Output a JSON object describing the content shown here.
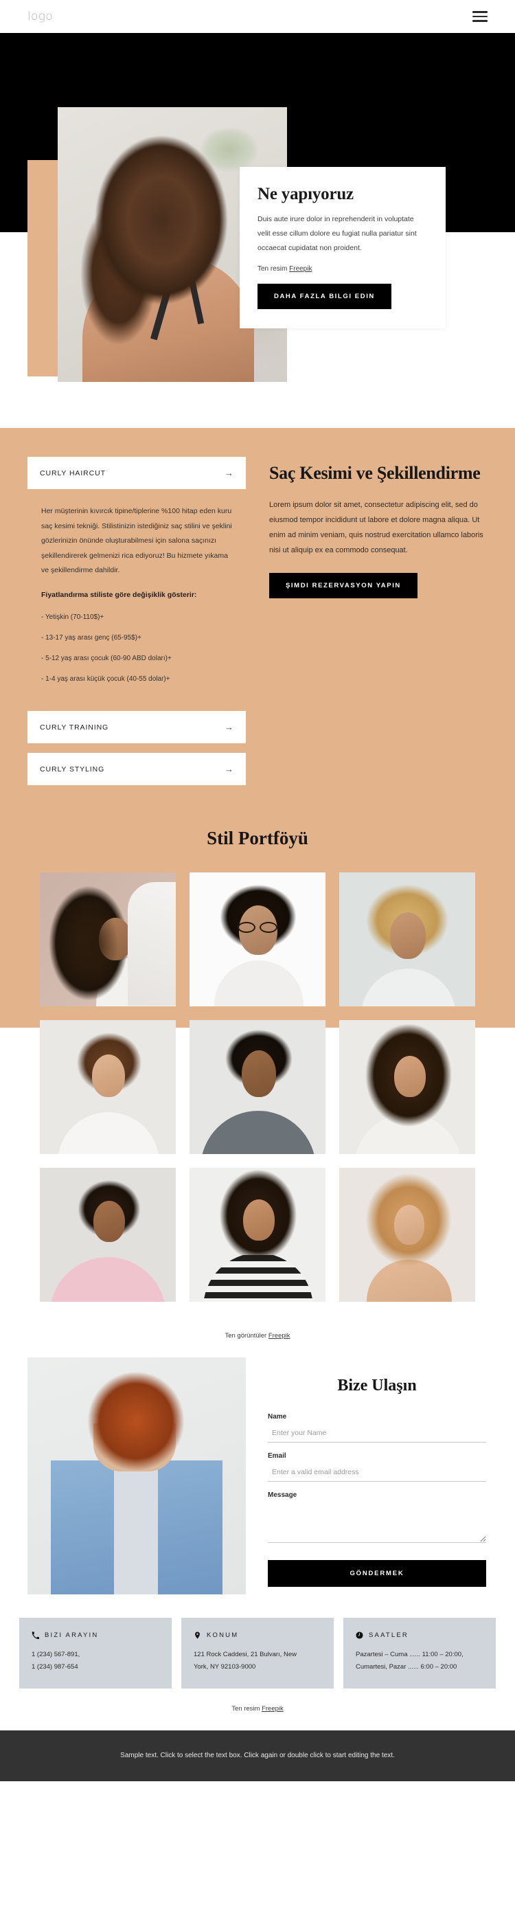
{
  "header": {
    "logo": "logo",
    "menu_icon": "hamburger-menu-icon"
  },
  "hero": {
    "card_title": "Ne yapıyoruz",
    "card_text": "Duis aute irure dolor in reprehenderit in voluptate velit esse cillum dolore eu fugiat nulla pariatur sint occaecat cupidatat non proident.",
    "credit_prefix": "Ten resim ",
    "credit_link": "Freepik",
    "cta": "DAHA FAZLA BILGI EDIN"
  },
  "services": {
    "accordion_open": {
      "label": "CURLY HAIRCUT",
      "arrow": "→"
    },
    "body_paragraph": "Her müşterinin kıvırcık tipine/tiplerine %100 hitap eden kuru saç kesimi tekniği. Stilistinizin istediğiniz saç stilini ve şeklini gözlerinizin önünde oluşturabilmesi için salona saçınızı şekillendirerek gelmenizi rica ediyoruz! Bu hizmete yıkama ve şekillendirme dahildir.",
    "pricing_heading": "Fiyatlandırma stiliste göre değişiklik gösterir:",
    "pricing_items": [
      "- Yetişkin (70-110$)+",
      "- 13-17 yaş arası genç (65-95$)+",
      "- 5-12 yaş arası çocuk (60-90 ABD doları)+",
      "- 1-4 yaş arası küçük çocuk (40-55 dolar)+"
    ],
    "accordion_items": [
      {
        "label": "CURLY TRAINING",
        "arrow": "→"
      },
      {
        "label": "CURLY STYLING",
        "arrow": "→"
      }
    ],
    "title": "Saç Kesimi ve Şekillendirme",
    "paragraph": "Lorem ipsum dolor sit amet, consectetur adipiscing elit, sed do eiusmod tempor incididunt ut labore et dolore magna aliqua. Ut enim ad minim veniam, quis nostrud exercitation ullamco laboris nisi ut aliquip ex ea commodo consequat.",
    "cta": "ŞIMDI REZERVASYON YAPIN"
  },
  "portfolio": {
    "title": "Stil Portföyü",
    "credit_prefix": "Ten görüntüler ",
    "credit_link": "Freepik",
    "images": [
      {
        "alt": "curly-hair-portrait-1"
      },
      {
        "alt": "curly-hair-portrait-2"
      },
      {
        "alt": "curly-hair-portrait-3"
      },
      {
        "alt": "curly-hair-portrait-4"
      },
      {
        "alt": "curly-hair-portrait-5"
      },
      {
        "alt": "curly-hair-portrait-6"
      },
      {
        "alt": "curly-hair-portrait-7"
      },
      {
        "alt": "curly-hair-portrait-8"
      },
      {
        "alt": "curly-hair-portrait-9"
      }
    ]
  },
  "contact": {
    "title": "Bize Ulaşın",
    "fields": [
      {
        "label": "Name",
        "placeholder": "Enter your Name",
        "value": ""
      },
      {
        "label": "Email",
        "placeholder": "Enter a valid email address",
        "value": ""
      },
      {
        "label": "Message",
        "placeholder": "",
        "value": ""
      }
    ],
    "submit": "GÖNDERMEK",
    "photo_alt": "red-haired-woman-denim-jacket"
  },
  "info_cards": [
    {
      "icon": "phone-icon",
      "title": "BIZI ARAYIN",
      "lines": [
        "1 (234) 567-891,",
        "1 (234) 987-654"
      ]
    },
    {
      "icon": "location-pin-icon",
      "title": "KONUM",
      "lines": [
        "121 Rock Caddesi, 21 Bulvarı, New",
        "York, NY 92103-9000"
      ]
    },
    {
      "icon": "clock-icon",
      "title": "SAATLER",
      "lines": [
        "Pazartesi – Cuma ...... 11:00 – 20:00,",
        "Cumartesi, Pazar ...... 6:00 – 20:00"
      ]
    }
  ],
  "bottom_credit": {
    "prefix": "Ten resim ",
    "link": "Freepik"
  },
  "footer": {
    "text": "Sample text. Click to select the text box. Click again or double click to start editing the text."
  },
  "colors": {
    "tan": "#e3b48c",
    "black": "#000000",
    "info_card": "#cfd5da",
    "footer": "#333333"
  }
}
